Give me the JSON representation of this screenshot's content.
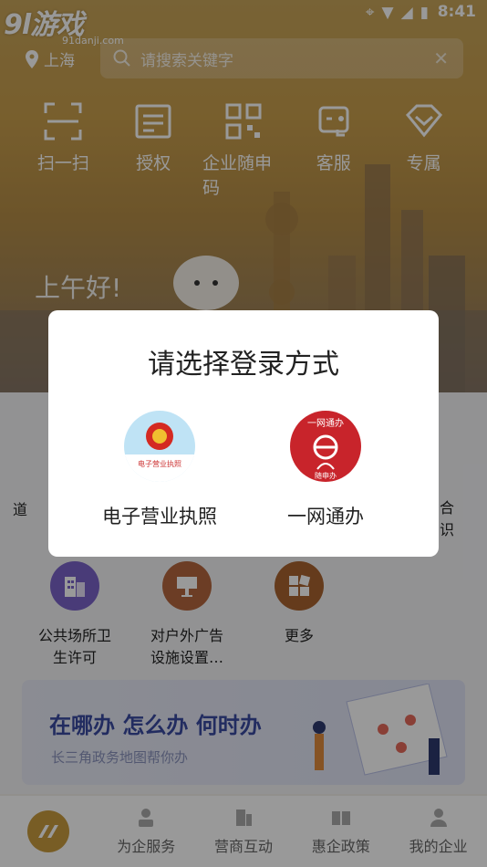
{
  "status_bar": {
    "time": "8:41"
  },
  "watermark": {
    "big": "9l游戏",
    "small": "91danji.com"
  },
  "header": {
    "location": "上海",
    "search_placeholder": "请搜索关键字",
    "quick_actions": [
      {
        "label": "扫一扫",
        "icon": "scan-icon"
      },
      {
        "label": "授权",
        "icon": "authorize-icon"
      },
      {
        "label": "企业随申码",
        "icon": "qr-code-icon"
      },
      {
        "label": "客服",
        "icon": "customer-service-icon"
      },
      {
        "label": "专属",
        "icon": "exclusive-icon"
      }
    ],
    "greeting": "上午好!"
  },
  "services": {
    "partial_left": "道",
    "partial_right_1": "合",
    "partial_right_2": "识",
    "items": [
      {
        "label": "公共场所卫生许可",
        "line1": "公共场所卫",
        "line2": "生许可",
        "color": "#7a63c9"
      },
      {
        "label": "对户外广告设施设置…",
        "line1": "对户外广告",
        "line2": "设施设置…",
        "color": "#b5673e"
      },
      {
        "label": "更多",
        "line1": "更多",
        "line2": "",
        "color": "#a8632f"
      }
    ]
  },
  "banner": {
    "title": "在哪办 怎么办 何时办",
    "subtitle": "长三角政务地图帮你办"
  },
  "tabbar": {
    "items": [
      {
        "label": "为企服务",
        "icon": "service-icon"
      },
      {
        "label": "营商互动",
        "icon": "interaction-icon"
      },
      {
        "label": "惠企政策",
        "icon": "policy-icon"
      },
      {
        "label": "我的企业",
        "icon": "my-company-icon"
      }
    ]
  },
  "dialog": {
    "title": "请选择登录方式",
    "options": [
      {
        "label": "电子营业执照",
        "logo_text": "电子营业执照",
        "icon": "national-emblem-icon"
      },
      {
        "label": "一网通办",
        "logo_text_top": "一网通办",
        "logo_text_bottom": "随申办",
        "icon": "one-network-icon"
      }
    ]
  },
  "colors": {
    "accent": "#c99b3f",
    "banner_title": "#3a4aa0",
    "onecard_red": "#c8242b"
  }
}
